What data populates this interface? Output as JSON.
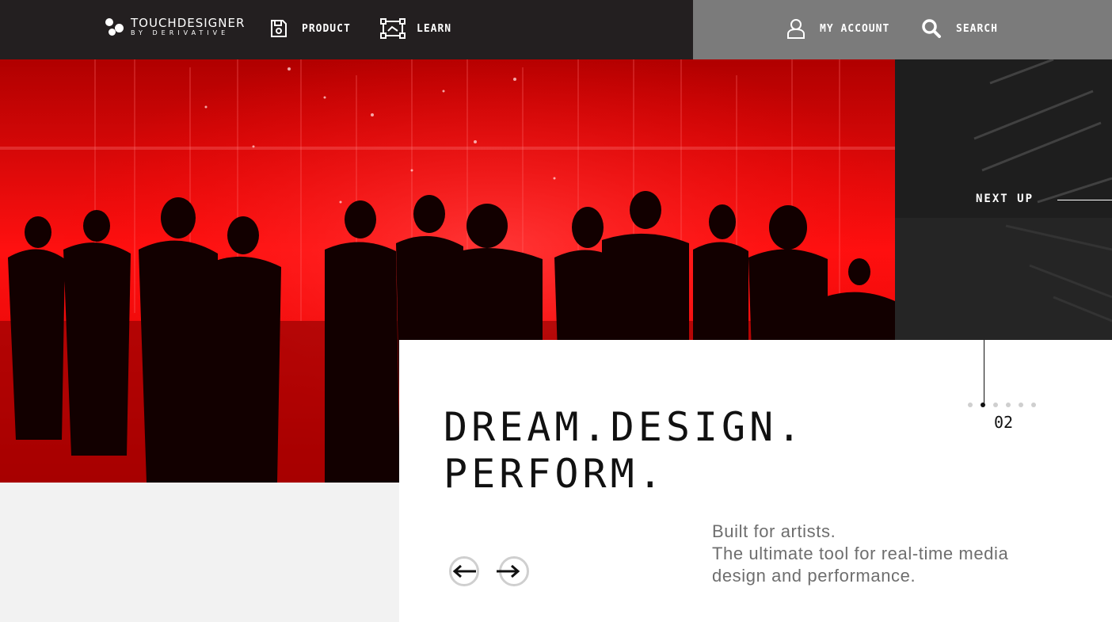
{
  "brand": {
    "title": "TOUCHDESIGNER",
    "subtitle": "BY DERIVATIVE"
  },
  "nav": {
    "product_label": "PRODUCT",
    "learn_label": "LEARN",
    "account_label": "MY ACCOUNT",
    "search_label": "SEARCH"
  },
  "hero": {
    "headline_line1": "DREAM.DESIGN.",
    "headline_line2": "PERFORM.",
    "sub_line1": "Built for artists.",
    "sub_line2": "The ultimate tool for real-time media",
    "sub_line3": "design and performance.",
    "next_up_label": "NEXT UP",
    "current_page": "02",
    "slide_count": 6,
    "active_slide_index": 1
  },
  "colors": {
    "nav_dark": "#231f20",
    "nav_gray": "#7b7b7b",
    "hero_red": "#e00000",
    "text_gray": "#6e6e6e"
  }
}
